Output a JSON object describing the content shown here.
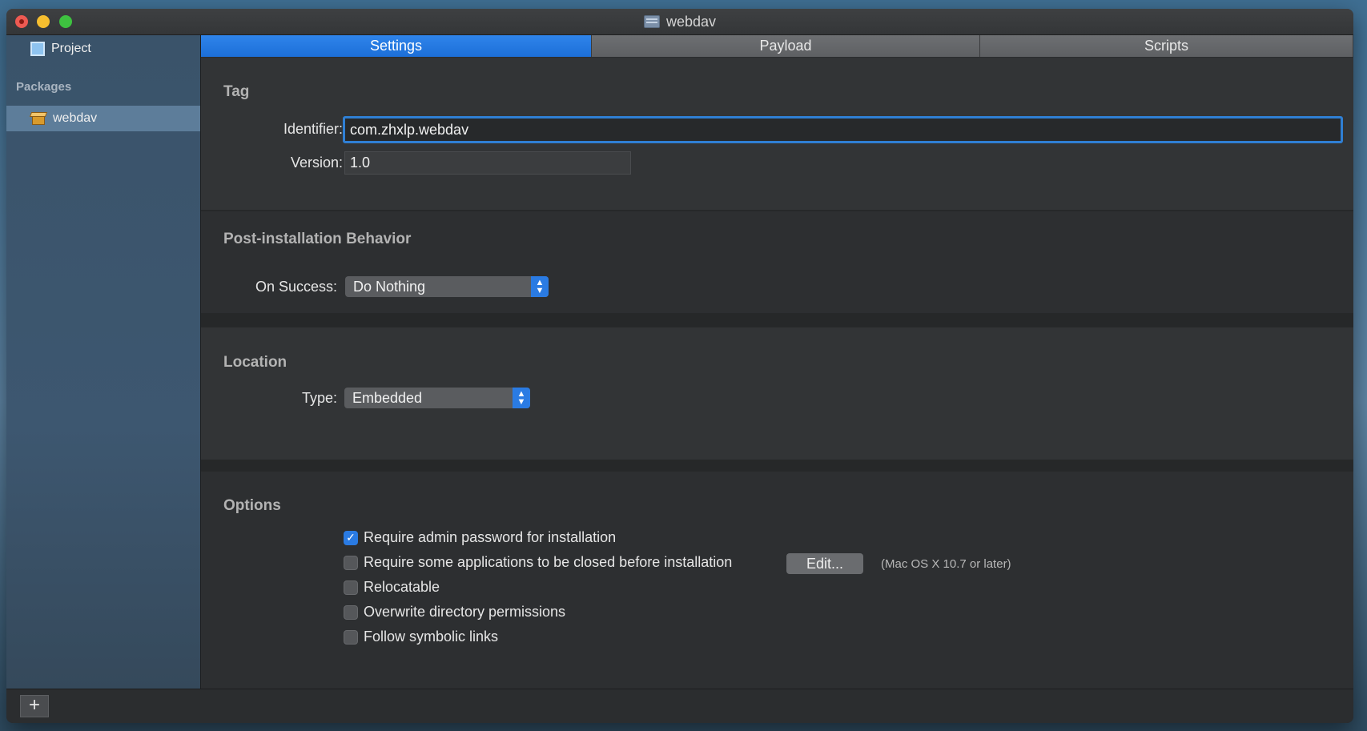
{
  "window": {
    "title": "webdav"
  },
  "sidebar": {
    "project_label": "Project",
    "packages_header": "Packages",
    "items": [
      {
        "label": "webdav",
        "selected": true
      }
    ]
  },
  "tabs": [
    {
      "label": "Settings",
      "active": true
    },
    {
      "label": "Payload",
      "active": false
    },
    {
      "label": "Scripts",
      "active": false
    }
  ],
  "tag_section": {
    "title": "Tag",
    "identifier_label": "Identifier:",
    "identifier_value": "com.zhxlp.webdav",
    "version_label": "Version:",
    "version_value": "1.0"
  },
  "post_install": {
    "title": "Post-installation Behavior",
    "on_success_label": "On Success:",
    "on_success_value": "Do Nothing"
  },
  "location": {
    "title": "Location",
    "type_label": "Type:",
    "type_value": "Embedded"
  },
  "options": {
    "title": "Options",
    "items": [
      {
        "label": "Require admin password for installation",
        "checked": true
      },
      {
        "label": "Require some applications to be closed before installation",
        "checked": false
      },
      {
        "label": "Relocatable",
        "checked": false
      },
      {
        "label": "Overwrite directory permissions",
        "checked": false
      },
      {
        "label": "Follow symbolic links",
        "checked": false
      }
    ],
    "edit_button": "Edit...",
    "edit_note": "(Mac OS X 10.7 or later)"
  },
  "bottombar": {
    "add_label": "+"
  },
  "colors": {
    "accent": "#2a7be3",
    "close": "#ee5a52",
    "minimize": "#f6be2f",
    "zoom": "#3ec240"
  }
}
